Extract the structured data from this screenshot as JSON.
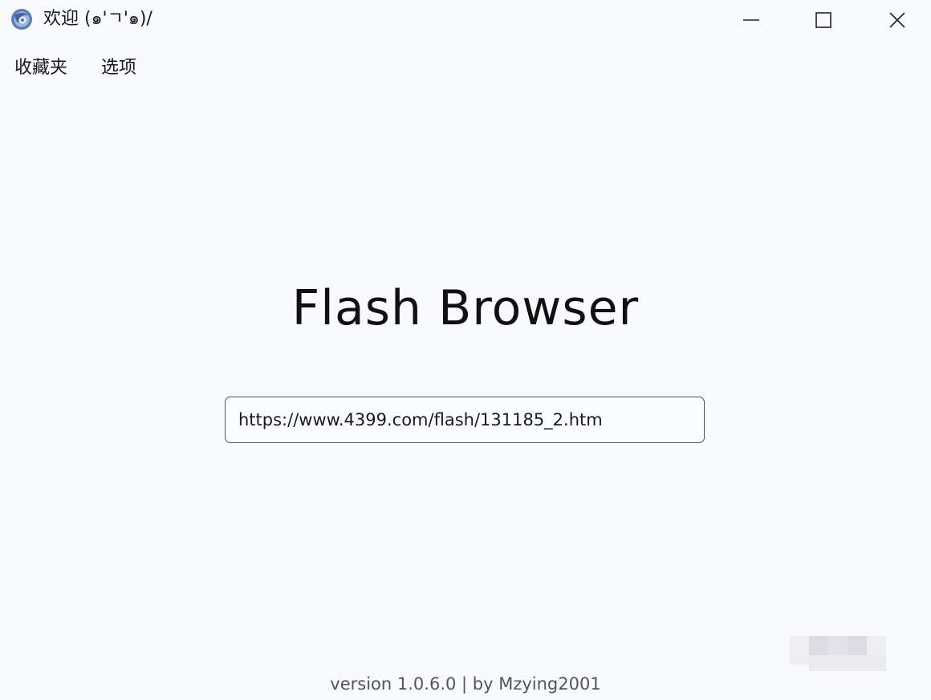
{
  "window": {
    "title": "欢迎 (๑'ㄱ'๑)/",
    "controls": {
      "minimize_icon": "minimize-icon",
      "maximize_icon": "maximize-icon",
      "close_icon": "close-icon"
    }
  },
  "menu": {
    "items": [
      {
        "label": "收藏夹"
      },
      {
        "label": "选项"
      }
    ]
  },
  "main": {
    "app_title": "Flash Browser",
    "url_input": {
      "value": "https://www.4399.com/flash/131185_2.htm"
    }
  },
  "footer": {
    "text": "version 1.0.6.0 | by Mzying2001"
  },
  "colors": {
    "background": "#f9fafe",
    "input_border": "#4b5568",
    "footer_text": "#555555"
  }
}
